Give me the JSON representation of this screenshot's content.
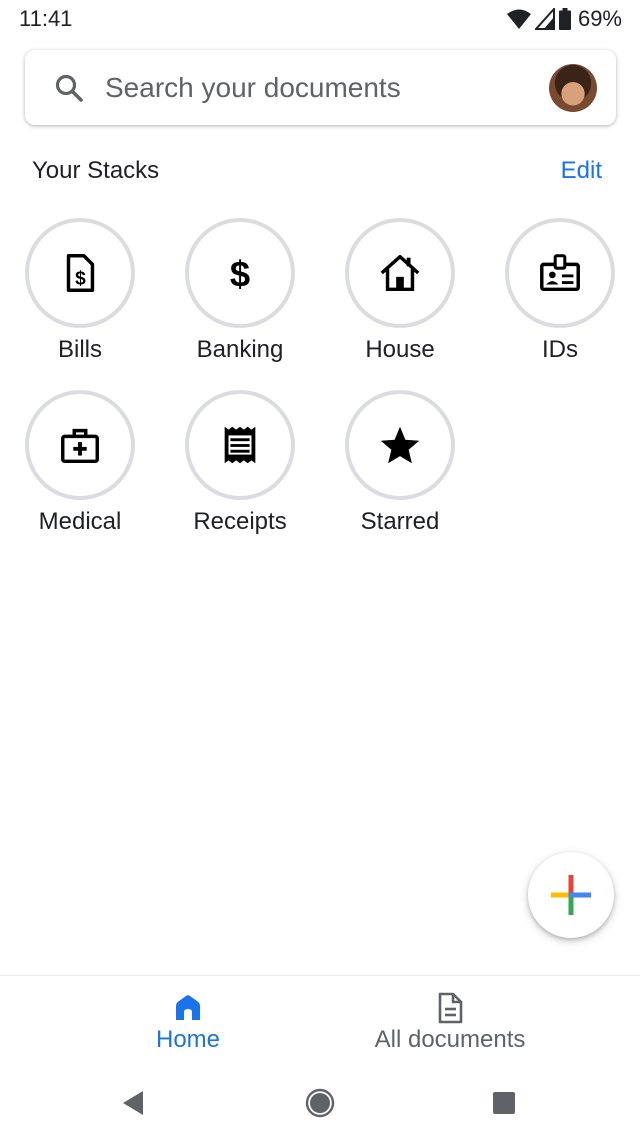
{
  "status_bar": {
    "time": "11:41",
    "battery": "69%"
  },
  "search": {
    "placeholder": "Search your documents"
  },
  "stacks": {
    "title": "Your Stacks",
    "edit_label": "Edit",
    "items": [
      {
        "label": "Bills",
        "icon": "bill-icon"
      },
      {
        "label": "Banking",
        "icon": "dollar-icon"
      },
      {
        "label": "House",
        "icon": "house-icon"
      },
      {
        "label": "IDs",
        "icon": "id-card-icon"
      },
      {
        "label": "Medical",
        "icon": "medical-kit-icon"
      },
      {
        "label": "Receipts",
        "icon": "receipt-icon"
      },
      {
        "label": "Starred",
        "icon": "star-icon"
      }
    ]
  },
  "fab": {
    "icon": "plus-icon"
  },
  "bottom_nav": {
    "items": [
      {
        "label": "Home",
        "icon": "home-icon",
        "active": true
      },
      {
        "label": "All documents",
        "icon": "document-icon",
        "active": false
      }
    ]
  },
  "colors": {
    "accent": "#1a73e8",
    "text": "#202124",
    "secondary_text": "#5f6368",
    "circle_border": "#dadce0",
    "fab_plus": [
      "#4285f4",
      "#ea4335",
      "#fbbc04",
      "#34a853"
    ]
  }
}
